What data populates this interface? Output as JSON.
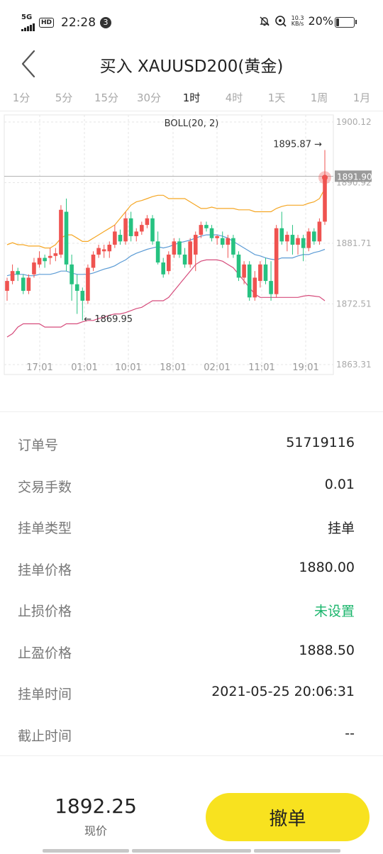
{
  "status_bar": {
    "network": "5G",
    "hd": "HD",
    "time": "22:28",
    "notification_count": "3",
    "speed_value": "10.3",
    "speed_unit": "KB/s",
    "battery_percent": "20%",
    "battery_level": 0.2
  },
  "header": {
    "title": "买入 XAUUSD200(黄金)",
    "back_icon": "chevron-left-icon"
  },
  "timeframes": {
    "items": [
      "1分",
      "5分",
      "15分",
      "30分",
      "1时",
      "4时",
      "1天",
      "1周",
      "1月"
    ],
    "active": "1时"
  },
  "chart_data": {
    "type": "candlestick",
    "indicator_label": "BOLL(20, 2)",
    "y_ticks": [
      "1900.12",
      "1890.92",
      "1881.71",
      "1872.51",
      "1863.31"
    ],
    "x_ticks": [
      "17:01",
      "01:01",
      "10:01",
      "18:01",
      "02:01",
      "11:01",
      "19:01"
    ],
    "ylim": [
      1863.31,
      1900.12
    ],
    "current_price_tag": "1891.90",
    "max_label": "1895.87 →",
    "min_label": "← 1869.95",
    "series_colors": {
      "up": "#ef5350",
      "down": "#26c281",
      "upper_band": "#f5a623",
      "middle_band": "#5b9bd5",
      "lower_band": "#d64c7c"
    },
    "candles": [
      {
        "o": 1874.5,
        "h": 1876.5,
        "l": 1873.0,
        "c": 1876.0
      },
      {
        "o": 1876.0,
        "h": 1878.5,
        "l": 1875.5,
        "c": 1877.5
      },
      {
        "o": 1877.5,
        "h": 1878.0,
        "l": 1876.0,
        "c": 1877.0
      },
      {
        "o": 1876.5,
        "h": 1877.0,
        "l": 1874.0,
        "c": 1874.5
      },
      {
        "o": 1874.5,
        "h": 1877.0,
        "l": 1874.0,
        "c": 1876.5
      },
      {
        "o": 1877.0,
        "h": 1879.5,
        "l": 1876.5,
        "c": 1878.8
      },
      {
        "o": 1878.5,
        "h": 1880.5,
        "l": 1878.0,
        "c": 1879.5
      },
      {
        "o": 1879.5,
        "h": 1880.0,
        "l": 1878.0,
        "c": 1879.0
      },
      {
        "o": 1879.5,
        "h": 1881.0,
        "l": 1878.5,
        "c": 1879.8
      },
      {
        "o": 1879.8,
        "h": 1881.0,
        "l": 1879.0,
        "c": 1880.2
      },
      {
        "o": 1880.0,
        "h": 1887.5,
        "l": 1879.5,
        "c": 1886.8
      },
      {
        "o": 1886.5,
        "h": 1888.5,
        "l": 1877.5,
        "c": 1878.5
      },
      {
        "o": 1878.5,
        "h": 1880.0,
        "l": 1873.0,
        "c": 1875.5
      },
      {
        "o": 1875.5,
        "h": 1877.0,
        "l": 1871.0,
        "c": 1874.5
      },
      {
        "o": 1874.5,
        "h": 1875.0,
        "l": 1870.0,
        "c": 1873.0
      },
      {
        "o": 1873.0,
        "h": 1878.5,
        "l": 1872.5,
        "c": 1878.0
      },
      {
        "o": 1878.0,
        "h": 1880.5,
        "l": 1877.5,
        "c": 1880.0
      },
      {
        "o": 1880.0,
        "h": 1881.5,
        "l": 1879.5,
        "c": 1881.0
      },
      {
        "o": 1880.5,
        "h": 1881.5,
        "l": 1879.5,
        "c": 1880.8
      },
      {
        "o": 1880.5,
        "h": 1882.0,
        "l": 1879.5,
        "c": 1881.5
      },
      {
        "o": 1881.5,
        "h": 1884.5,
        "l": 1881.0,
        "c": 1883.5
      },
      {
        "o": 1883.0,
        "h": 1883.8,
        "l": 1881.5,
        "c": 1882.0
      },
      {
        "o": 1882.0,
        "h": 1886.5,
        "l": 1881.5,
        "c": 1885.5
      },
      {
        "o": 1885.5,
        "h": 1886.5,
        "l": 1882.0,
        "c": 1882.8
      },
      {
        "o": 1882.8,
        "h": 1884.0,
        "l": 1882.0,
        "c": 1883.5
      },
      {
        "o": 1883.5,
        "h": 1885.0,
        "l": 1883.0,
        "c": 1884.5
      },
      {
        "o": 1884.5,
        "h": 1886.0,
        "l": 1884.0,
        "c": 1885.5
      },
      {
        "o": 1885.5,
        "h": 1886.0,
        "l": 1881.5,
        "c": 1882.0
      },
      {
        "o": 1882.0,
        "h": 1883.5,
        "l": 1878.5,
        "c": 1878.8
      },
      {
        "o": 1878.8,
        "h": 1879.5,
        "l": 1876.5,
        "c": 1877.0
      },
      {
        "o": 1877.5,
        "h": 1880.5,
        "l": 1877.0,
        "c": 1880.0
      },
      {
        "o": 1880.0,
        "h": 1882.5,
        "l": 1879.5,
        "c": 1882.0
      },
      {
        "o": 1882.0,
        "h": 1882.5,
        "l": 1879.5,
        "c": 1880.0
      },
      {
        "o": 1880.0,
        "h": 1881.0,
        "l": 1878.0,
        "c": 1878.5
      },
      {
        "o": 1878.5,
        "h": 1882.5,
        "l": 1878.0,
        "c": 1882.0
      },
      {
        "o": 1880.0,
        "h": 1883.5,
        "l": 1877.5,
        "c": 1883.0
      },
      {
        "o": 1883.0,
        "h": 1885.0,
        "l": 1882.5,
        "c": 1884.5
      },
      {
        "o": 1884.5,
        "h": 1885.0,
        "l": 1883.5,
        "c": 1884.0
      },
      {
        "o": 1884.0,
        "h": 1884.5,
        "l": 1882.0,
        "c": 1882.5
      },
      {
        "o": 1882.5,
        "h": 1883.0,
        "l": 1881.5,
        "c": 1882.8
      },
      {
        "o": 1882.5,
        "h": 1883.5,
        "l": 1881.0,
        "c": 1881.5
      },
      {
        "o": 1881.5,
        "h": 1883.0,
        "l": 1879.5,
        "c": 1882.5
      },
      {
        "o": 1882.5,
        "h": 1883.0,
        "l": 1879.5,
        "c": 1880.0
      },
      {
        "o": 1880.0,
        "h": 1880.5,
        "l": 1876.0,
        "c": 1876.5
      },
      {
        "o": 1876.5,
        "h": 1879.0,
        "l": 1875.5,
        "c": 1878.5
      },
      {
        "o": 1878.5,
        "h": 1879.0,
        "l": 1873.0,
        "c": 1873.5
      },
      {
        "o": 1873.5,
        "h": 1877.5,
        "l": 1873.0,
        "c": 1876.5
      },
      {
        "o": 1876.0,
        "h": 1879.0,
        "l": 1875.0,
        "c": 1878.5
      },
      {
        "o": 1878.5,
        "h": 1879.5,
        "l": 1875.5,
        "c": 1876.0
      },
      {
        "o": 1876.0,
        "h": 1879.0,
        "l": 1873.0,
        "c": 1874.0
      },
      {
        "o": 1874.0,
        "h": 1884.5,
        "l": 1873.5,
        "c": 1884.0
      },
      {
        "o": 1884.0,
        "h": 1886.5,
        "l": 1881.5,
        "c": 1882.0
      },
      {
        "o": 1882.0,
        "h": 1883.5,
        "l": 1880.5,
        "c": 1883.0
      },
      {
        "o": 1883.0,
        "h": 1884.5,
        "l": 1880.0,
        "c": 1881.5
      },
      {
        "o": 1881.5,
        "h": 1883.0,
        "l": 1880.0,
        "c": 1882.5
      },
      {
        "o": 1882.5,
        "h": 1883.0,
        "l": 1879.0,
        "c": 1881.0
      },
      {
        "o": 1881.0,
        "h": 1884.0,
        "l": 1880.5,
        "c": 1883.5
      },
      {
        "o": 1883.5,
        "h": 1884.0,
        "l": 1881.5,
        "c": 1882.0
      },
      {
        "o": 1882.0,
        "h": 1885.5,
        "l": 1881.5,
        "c": 1885.0
      },
      {
        "o": 1885.0,
        "h": 1895.87,
        "l": 1884.5,
        "c": 1891.9
      }
    ],
    "upper_band": [
      1881.5,
      1881.8,
      1881.5,
      1881.5,
      1881.3,
      1881.3,
      1881.3,
      1881.0,
      1881.0,
      1881.5,
      1882.5,
      1883.0,
      1883.0,
      1882.5,
      1882.0,
      1882.0,
      1882.5,
      1883.0,
      1883.5,
      1884.0,
      1884.5,
      1885.5,
      1886.5,
      1887.5,
      1888.0,
      1888.2,
      1888.5,
      1888.8,
      1889.0,
      1889.0,
      1888.5,
      1888.5,
      1888.5,
      1888.5,
      1888.0,
      1887.5,
      1887.0,
      1887.0,
      1887.2,
      1887.0,
      1887.0,
      1887.0,
      1887.0,
      1886.8,
      1886.8,
      1886.8,
      1886.5,
      1886.5,
      1886.5,
      1886.5,
      1887.0,
      1887.3,
      1887.5,
      1887.5,
      1887.5,
      1887.5,
      1887.8,
      1888.0,
      1888.5,
      1890.0
    ],
    "middle_band": [
      1876.8,
      1877.0,
      1877.0,
      1877.0,
      1876.8,
      1876.8,
      1877.0,
      1877.0,
      1877.0,
      1877.2,
      1877.5,
      1877.5,
      1877.2,
      1877.0,
      1877.0,
      1877.0,
      1877.2,
      1877.5,
      1877.8,
      1878.0,
      1878.3,
      1878.8,
      1879.2,
      1879.8,
      1880.2,
      1880.5,
      1880.8,
      1881.0,
      1881.2,
      1881.0,
      1881.2,
      1881.5,
      1881.8,
      1882.0,
      1882.2,
      1882.5,
      1882.8,
      1883.0,
      1883.0,
      1883.0,
      1882.8,
      1882.5,
      1882.0,
      1881.5,
      1881.0,
      1880.5,
      1880.0,
      1879.8,
      1879.5,
      1879.3,
      1879.2,
      1879.5,
      1879.5,
      1879.5,
      1879.8,
      1880.0,
      1880.0,
      1880.3,
      1880.5,
      1880.8
    ],
    "lower_band": [
      1867.5,
      1868.0,
      1869.0,
      1869.5,
      1869.5,
      1869.5,
      1869.5,
      1869.0,
      1869.0,
      1869.0,
      1869.0,
      1869.5,
      1869.5,
      1869.5,
      1869.8,
      1870.0,
      1870.0,
      1870.3,
      1870.5,
      1870.8,
      1871.0,
      1871.0,
      1871.2,
      1871.5,
      1871.8,
      1872.0,
      1872.5,
      1873.0,
      1873.0,
      1873.0,
      1873.5,
      1874.5,
      1875.5,
      1876.5,
      1877.5,
      1878.5,
      1879.0,
      1879.2,
      1879.2,
      1879.2,
      1879.0,
      1878.5,
      1878.0,
      1877.0,
      1876.0,
      1875.0,
      1874.0,
      1873.5,
      1873.5,
      1873.5,
      1873.5,
      1873.5,
      1873.5,
      1873.5,
      1873.5,
      1873.7,
      1873.8,
      1873.7,
      1873.6,
      1873.0
    ]
  },
  "order_details": [
    {
      "label": "订单号",
      "value": "51719116",
      "color": "#222222"
    },
    {
      "label": "交易手数",
      "value": "0.01",
      "color": "#222222"
    },
    {
      "label": "挂单类型",
      "value": "挂单",
      "color": "#222222"
    },
    {
      "label": "挂单价格",
      "value": "1880.00",
      "color": "#222222"
    },
    {
      "label": "止损价格",
      "value": "未设置",
      "color": "#19b56b"
    },
    {
      "label": "止盈价格",
      "value": "1888.50",
      "color": "#222222"
    },
    {
      "label": "挂单时间",
      "value": "2021-05-25 20:06:31",
      "color": "#222222"
    },
    {
      "label": "截止时间",
      "value": "--",
      "color": "#222222"
    }
  ],
  "footer": {
    "current_price": "1892.25",
    "current_price_label": "现价",
    "cancel_button_label": "撤单",
    "button_color": "#f8e21f"
  }
}
